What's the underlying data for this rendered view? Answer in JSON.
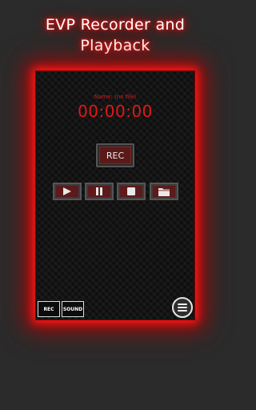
{
  "promo": {
    "title_line1": "EVP Recorder and",
    "title_line2": "Playback"
  },
  "recorder": {
    "file_name_label": "Name: (no file)",
    "timer": "00:00:00",
    "rec_button_label": "REC"
  },
  "transport": {
    "play_icon": "play-icon",
    "pause_icon": "pause-icon",
    "stop_icon": "stop-icon",
    "folder_icon": "folder-icon"
  },
  "bottom_bar": {
    "rec_tab_label": "REC",
    "sound_tab_label": "SOUND",
    "menu_icon": "hamburger-menu-icon"
  },
  "colors": {
    "accent_red": "#e01818",
    "glow_red": "#ff1a1a",
    "background": "#2b2b2b"
  }
}
